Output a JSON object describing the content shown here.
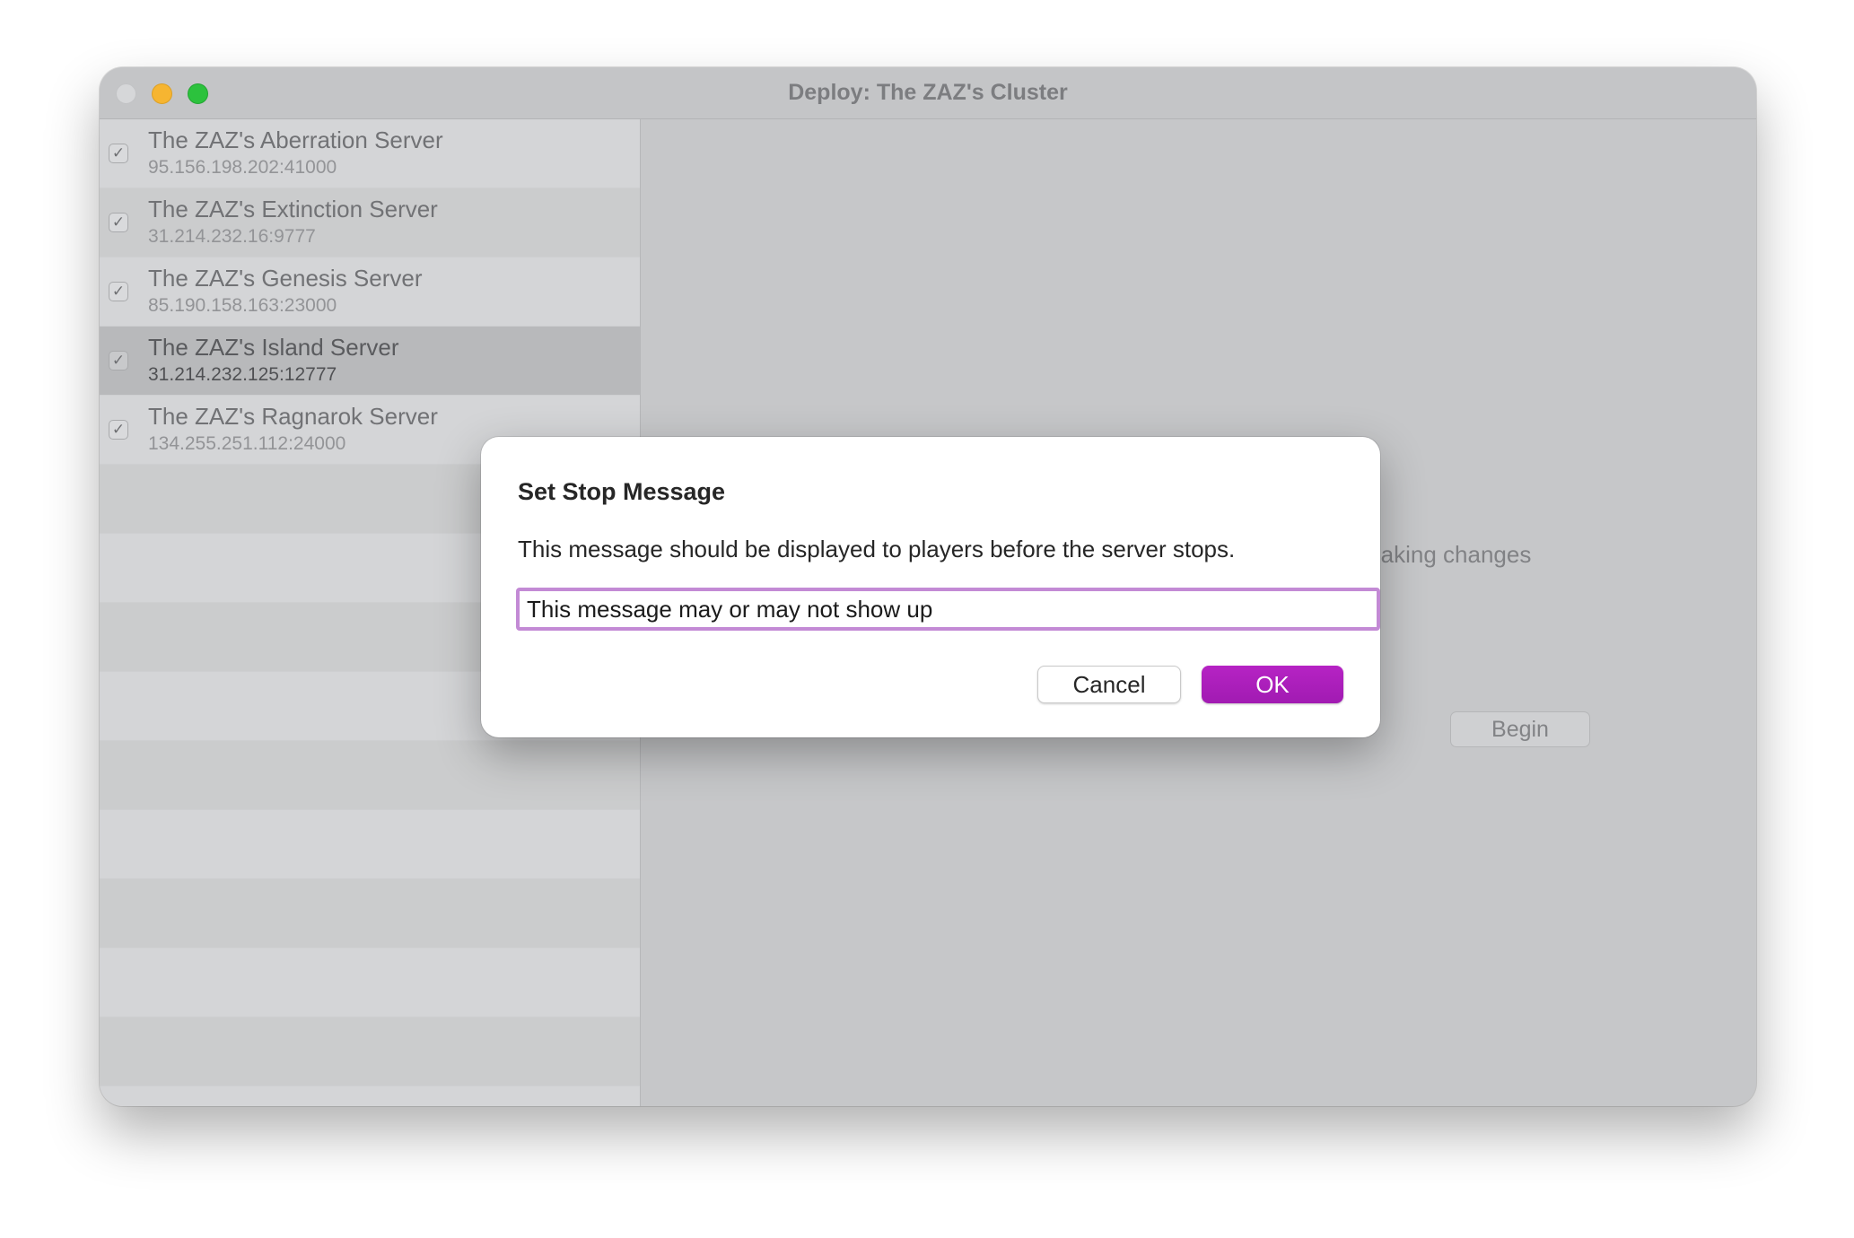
{
  "window": {
    "title": "Deploy: The ZAZ's Cluster"
  },
  "sidebar": {
    "servers": [
      {
        "name": "The ZAZ's Aberration Server",
        "address": "95.156.198.202:41000",
        "checked": true
      },
      {
        "name": "The ZAZ's Extinction Server",
        "address": "31.214.232.16:9777",
        "checked": true
      },
      {
        "name": "The ZAZ's Genesis Server",
        "address": "85.190.158.163:23000",
        "checked": true
      },
      {
        "name": "The ZAZ's Island Server",
        "address": "31.214.232.125:12777",
        "checked": true,
        "selected": true
      },
      {
        "name": "The ZAZ's Ragnarok Server",
        "address": "134.255.251.112:24000",
        "checked": true
      }
    ],
    "check_glyph": "✓"
  },
  "main": {
    "partial_text": "making changes",
    "begin_label": "Begin"
  },
  "dialog": {
    "title": "Set Stop Message",
    "message": "This message should be displayed to players before the server stops.",
    "input_value": "This message may or may not show up",
    "cancel_label": "Cancel",
    "ok_label": "OK"
  },
  "colors": {
    "accent": "#b623c4",
    "focus_ring": "#c38ad5",
    "traffic_close": "#d6d7d9",
    "traffic_minimize": "#f6b531",
    "traffic_maximize": "#2cc23d"
  }
}
